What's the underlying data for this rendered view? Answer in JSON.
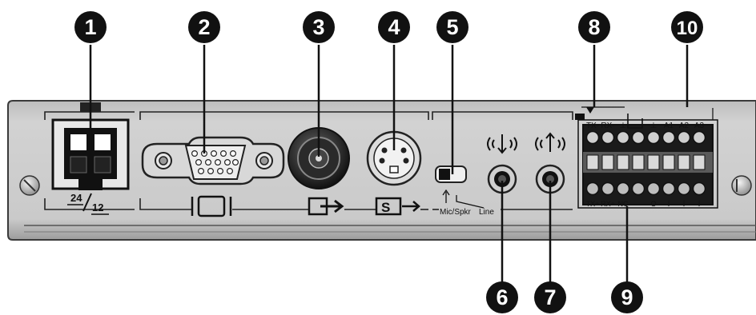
{
  "callouts": [
    "1",
    "2",
    "3",
    "4",
    "5",
    "6",
    "7",
    "8",
    "9",
    "10"
  ],
  "panel_labels": {
    "power_top": "24",
    "power_bottom": "12",
    "switch_mic": "Mic/Spkr",
    "switch_line": "Line",
    "terminal_top": [
      "TX-",
      "RX-",
      "⊥",
      "",
      "⊥",
      "A1",
      "A2",
      "A3"
    ],
    "terminal_bottom": [
      "TX+",
      "RX+",
      "NC",
      "",
      "O",
      "⏚",
      "⏚",
      "⏚"
    ]
  },
  "colors": {
    "panel": "#c9c9c9",
    "panel_border": "#3a3a3a",
    "callout": "#111111",
    "callout_text": "#ffffff",
    "leader": "#111111"
  }
}
